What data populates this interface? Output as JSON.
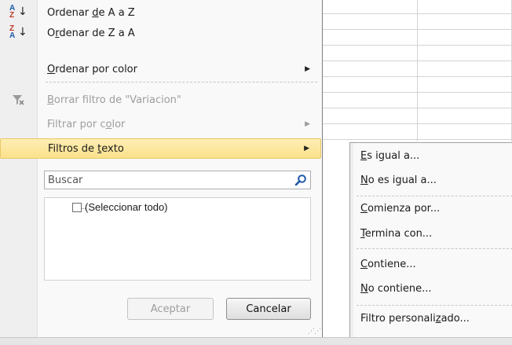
{
  "menu": {
    "sort_az": {
      "pre": "Ordenar ",
      "key": "d",
      "post": "e A a Z"
    },
    "sort_za": {
      "pre": "O",
      "key": "r",
      "post": "denar de Z a A"
    },
    "sort_color": {
      "pre": "",
      "key": "O",
      "post": "rdenar por color"
    },
    "clear_filter": {
      "pre": "",
      "key": "B",
      "post": "orrar filtro de \"Variacion\""
    },
    "filter_color": {
      "pre": "Filtrar por c",
      "key": "o",
      "post": "lor"
    },
    "text_filters": {
      "pre": "Filtros de ",
      "key": "t",
      "post": "exto"
    }
  },
  "search": {
    "placeholder": "Buscar"
  },
  "list": {
    "select_all": "(Seleccionar todo)"
  },
  "buttons": {
    "ok": "Aceptar",
    "cancel": "Cancelar"
  },
  "submenu": {
    "equals": {
      "pre": "",
      "key": "E",
      "post": "s igual a..."
    },
    "not_equals": {
      "pre": "",
      "key": "N",
      "post": "o es igual a..."
    },
    "begins_with": {
      "pre": "",
      "key": "C",
      "post": "omienza por..."
    },
    "ends_with": {
      "pre": "",
      "key": "T",
      "post": "ermina con..."
    },
    "contains": {
      "pre": "",
      "key": "C",
      "post": "ontiene..."
    },
    "not_contains": {
      "pre": "",
      "key": "N",
      "post": "o contiene..."
    },
    "custom": {
      "pre": "Filtro personali",
      "key": "z",
      "post": "ado..."
    }
  },
  "colors": {
    "highlight": "#fbe18c",
    "accent_blue": "#1e5aa8",
    "accent_red": "#c0392b"
  },
  "icons": [
    "sort-az-icon",
    "sort-za-icon",
    "clear-filter-icon",
    "search-icon",
    "submenu-arrow-icon",
    "checkbox-icon",
    "resize-grip-icon"
  ]
}
